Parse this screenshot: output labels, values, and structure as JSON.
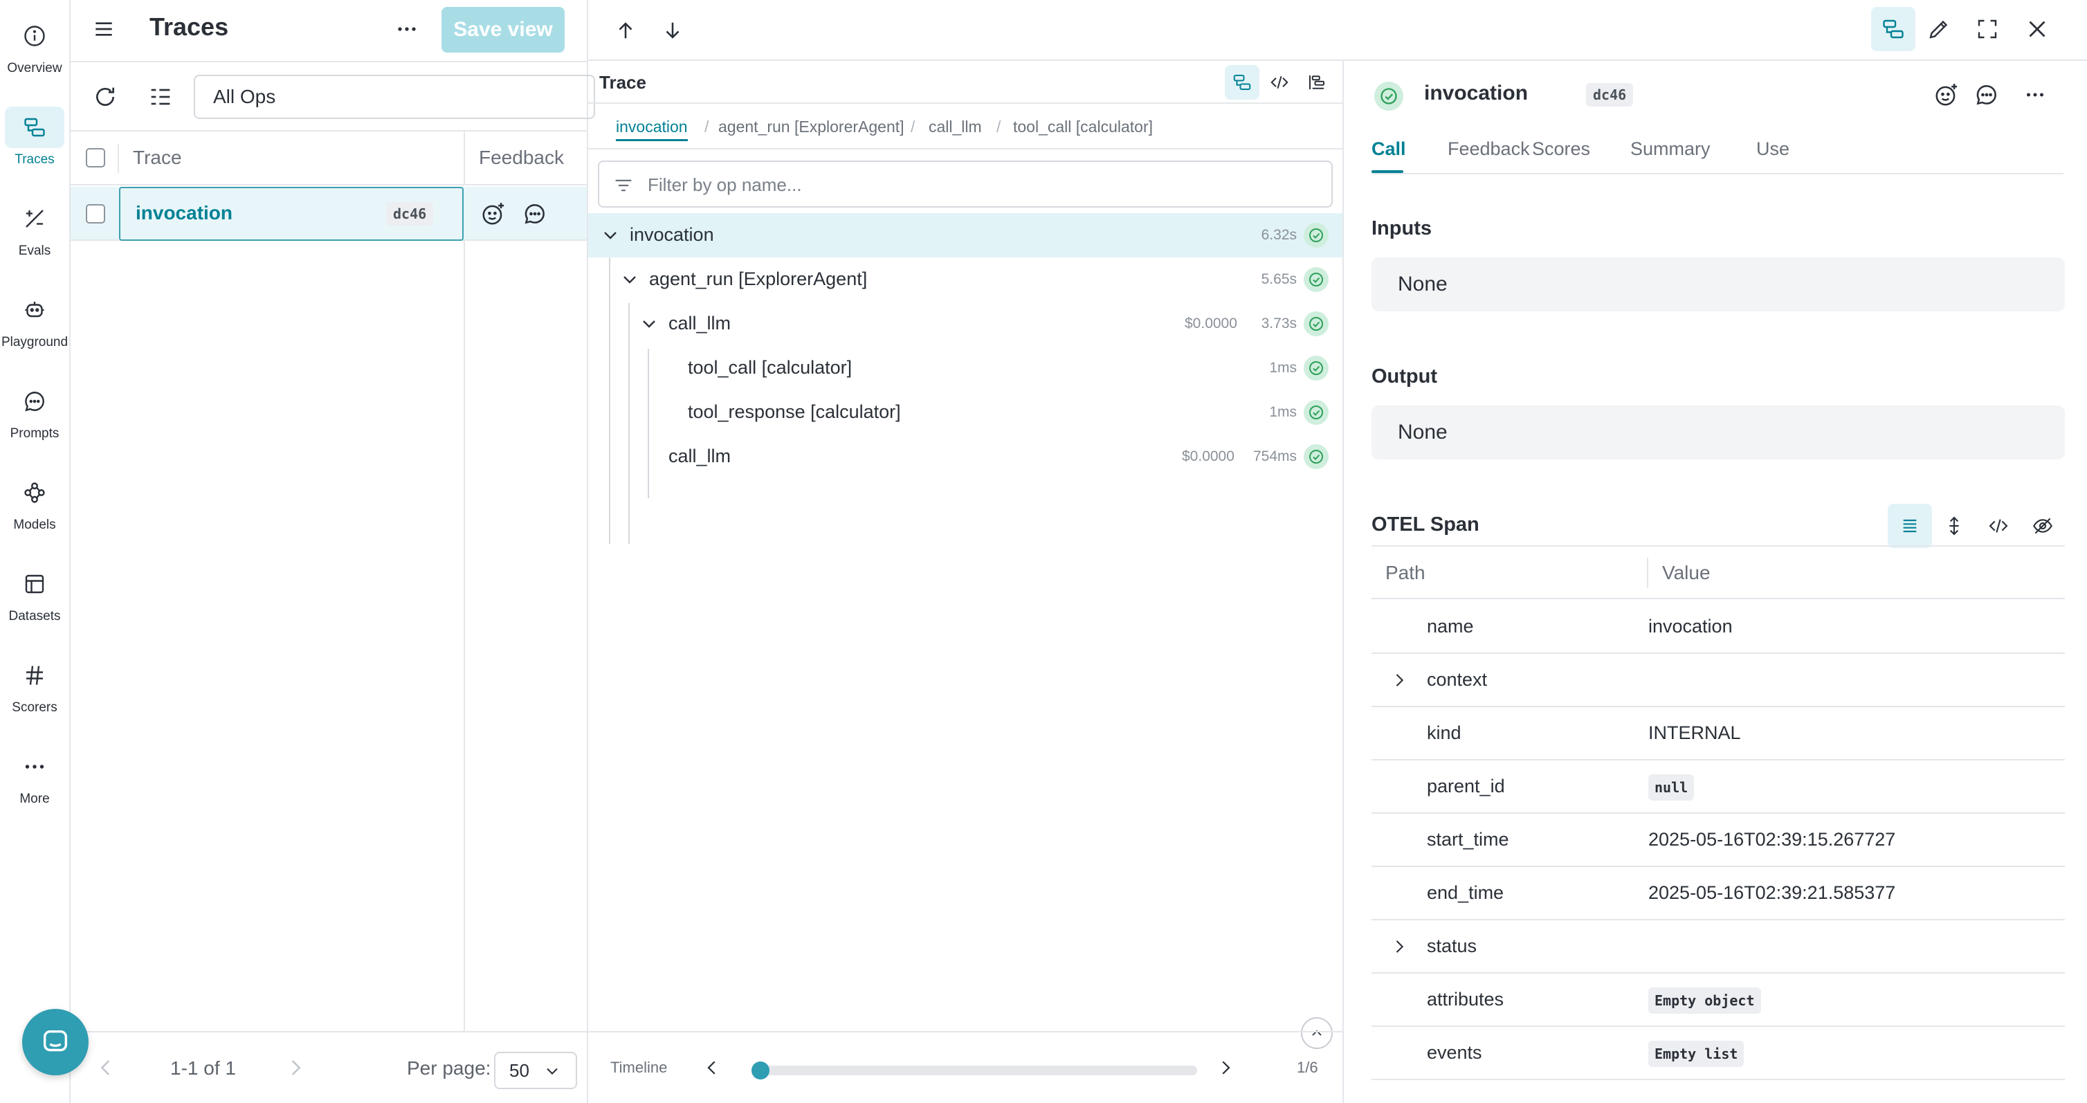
{
  "nav": {
    "items": [
      {
        "label": "Overview",
        "icon": "info-circle-icon"
      },
      {
        "label": "Traces",
        "icon": "traces-icon",
        "active": true
      },
      {
        "label": "Evals",
        "icon": "evals-icon"
      },
      {
        "label": "Playground",
        "icon": "playground-robot-icon"
      },
      {
        "label": "Prompts",
        "icon": "chat-bubble-icon"
      },
      {
        "label": "Models",
        "icon": "models-icon"
      },
      {
        "label": "Datasets",
        "icon": "table-icon"
      },
      {
        "label": "Scorers",
        "icon": "hash-icon"
      },
      {
        "label": "More",
        "icon": "dots-icon"
      }
    ]
  },
  "traces_panel": {
    "title": "Traces",
    "save_view_label": "Save view",
    "ops_filter_value": "All Ops",
    "columns": {
      "trace": "Trace",
      "feedback": "Feedback"
    },
    "rows": [
      {
        "name": "invocation",
        "hash": "dc46"
      }
    ],
    "pager": {
      "range": "1-1 of 1",
      "per_page_label": "Per page:",
      "per_page_value": "50"
    }
  },
  "trace_panel": {
    "title": "Trace",
    "breadcrumbs": [
      "invocation",
      "agent_run [ExplorerAgent]",
      "call_llm",
      "tool_call [calculator]"
    ],
    "filter_placeholder": "Filter by op name...",
    "tree": [
      {
        "name": "invocation",
        "cost": "",
        "duration": "6.32s",
        "selected": true
      },
      {
        "name": "agent_run [ExplorerAgent]",
        "cost": "",
        "duration": "5.65s"
      },
      {
        "name": "call_llm",
        "cost": "$0.0000",
        "duration": "3.73s"
      },
      {
        "name": "tool_call [calculator]",
        "cost": "",
        "duration": "1ms"
      },
      {
        "name": "tool_response [calculator]",
        "cost": "",
        "duration": "1ms"
      },
      {
        "name": "call_llm",
        "cost": "$0.0000",
        "duration": "754ms"
      }
    ],
    "timeline": {
      "label": "Timeline",
      "count": "1/6",
      "position": 0.0
    }
  },
  "details": {
    "title": "invocation",
    "hash": "dc46",
    "tabs": [
      "Call",
      "Feedback",
      "Scores",
      "Summary",
      "Use"
    ],
    "inputs_title": "Inputs",
    "inputs_value": "None",
    "output_title": "Output",
    "output_value": "None",
    "otel_title": "OTEL Span",
    "otel_columns": {
      "path": "Path",
      "value": "Value"
    },
    "otel_rows": [
      {
        "path": "name",
        "value": "invocation"
      },
      {
        "path": "context",
        "value": ""
      },
      {
        "path": "kind",
        "value": "INTERNAL"
      },
      {
        "path": "parent_id",
        "value": "null"
      },
      {
        "path": "start_time",
        "value": "2025-05-16T02:39:15.267727"
      },
      {
        "path": "end_time",
        "value": "2025-05-16T02:39:21.585377"
      },
      {
        "path": "status",
        "value": ""
      },
      {
        "path": "attributes",
        "value": "Empty object"
      },
      {
        "path": "events",
        "value": "Empty list"
      }
    ]
  },
  "colors": {
    "accent": "#038194",
    "accent_bg": "#e1f3f7",
    "success": "#2fa05a"
  }
}
